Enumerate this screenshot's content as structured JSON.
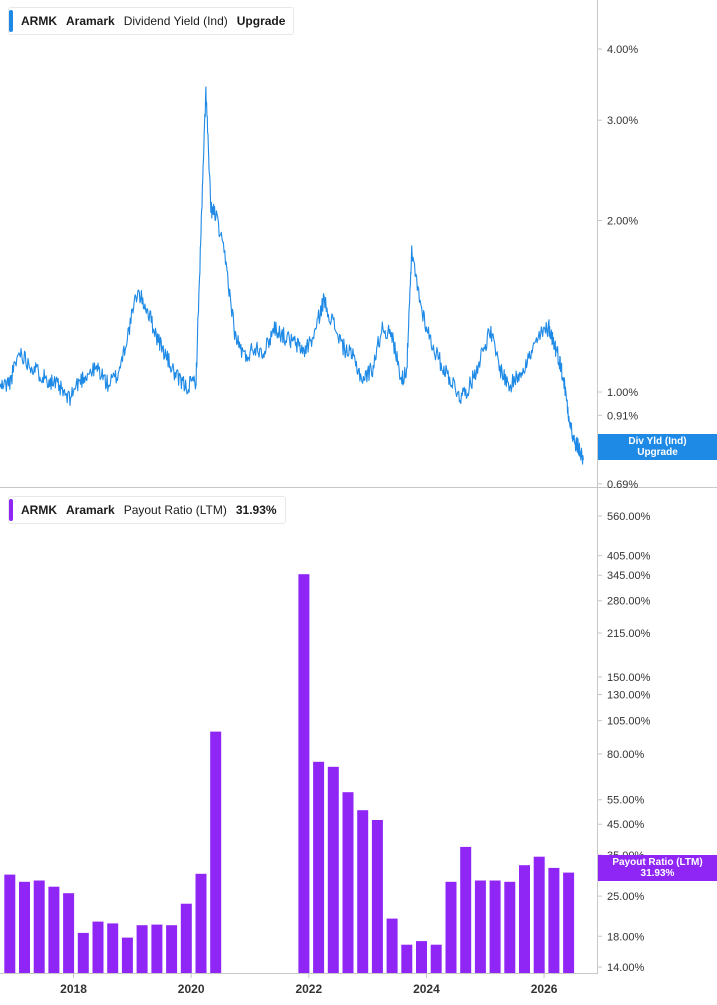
{
  "colors": {
    "yield": "#1e8ae6",
    "payout": "#9026f5",
    "axis": "#c8c8c8",
    "tick_text": "#333333"
  },
  "yield_panel": {
    "legend": {
      "ticker": "ARMK",
      "name": "Aramark",
      "metric": "Dividend Yield (Ind)",
      "value": "Upgrade"
    },
    "badge": {
      "line1": "Div Yld (Ind)",
      "line2": "Upgrade"
    }
  },
  "payout_panel": {
    "legend": {
      "ticker": "ARMK",
      "name": "Aramark",
      "metric": "Payout Ratio (LTM)",
      "value": "31.93%"
    },
    "badge": {
      "line1": "Payout Ratio (LTM)",
      "line2": "31.93%"
    }
  },
  "chart_data": [
    {
      "type": "line",
      "title": "ARMK Aramark Dividend Yield (Ind)",
      "series": [
        {
          "name": "Dividend Yield (Ind)",
          "unit": "%"
        }
      ],
      "y_scale": "log",
      "y_ticks": [
        {
          "value": 4.0,
          "label": "4.00%"
        },
        {
          "value": 3.0,
          "label": "3.00%"
        },
        {
          "value": 2.0,
          "label": "2.00%"
        },
        {
          "value": 1.0,
          "label": "1.00%"
        },
        {
          "value": 0.91,
          "label": "0.91%"
        },
        {
          "value": 0.69,
          "label": "0.69%"
        }
      ],
      "ylim": [
        0.69,
        4.5
      ],
      "xlim": [
        "2016-10",
        "2026-12"
      ],
      "x": [
        "2016-10",
        "2016-12",
        "2017-02",
        "2017-04",
        "2017-06",
        "2017-08",
        "2017-10",
        "2017-12",
        "2018-02",
        "2018-04",
        "2018-06",
        "2018-08",
        "2018-10",
        "2018-12",
        "2019-02",
        "2019-04",
        "2019-06",
        "2019-08",
        "2019-10",
        "2019-12",
        "2020-02",
        "2020-03",
        "2020-04",
        "2020-05",
        "2020-06",
        "2020-08",
        "2020-10",
        "2020-12",
        "2021-02",
        "2021-04",
        "2021-06",
        "2021-08",
        "2021-10",
        "2021-12",
        "2022-02",
        "2022-04",
        "2022-06",
        "2022-08",
        "2022-10",
        "2022-12",
        "2023-02",
        "2023-04",
        "2023-06",
        "2023-08",
        "2023-09",
        "2023-10",
        "2023-12",
        "2024-02",
        "2024-04",
        "2024-06",
        "2024-08",
        "2024-10",
        "2024-12",
        "2025-02",
        "2025-04",
        "2025-06",
        "2025-08",
        "2025-10",
        "2025-12",
        "2026-02",
        "2026-03",
        "2026-04",
        "2026-05",
        "2026-06",
        "2026-07",
        "2026-08",
        "2026-09"
      ],
      "values": [
        1.02,
        1.04,
        1.18,
        1.12,
        1.08,
        1.05,
        1.02,
        0.97,
        1.04,
        1.08,
        1.1,
        1.03,
        1.07,
        1.25,
        1.5,
        1.4,
        1.25,
        1.15,
        1.06,
        1.02,
        1.05,
        1.9,
        3.4,
        2.1,
        2.05,
        1.7,
        1.25,
        1.15,
        1.2,
        1.18,
        1.3,
        1.25,
        1.22,
        1.18,
        1.25,
        1.45,
        1.32,
        1.2,
        1.15,
        1.05,
        1.1,
        1.3,
        1.25,
        1.05,
        1.1,
        1.75,
        1.4,
        1.22,
        1.12,
        1.05,
        0.98,
        1.03,
        1.15,
        1.28,
        1.1,
        1.02,
        1.08,
        1.15,
        1.25,
        1.3,
        1.22,
        1.15,
        1.05,
        0.92,
        0.82,
        0.8,
        0.76
      ]
    },
    {
      "type": "bar",
      "title": "ARMK Aramark Payout Ratio (LTM)",
      "series": [
        {
          "name": "Payout Ratio (LTM)",
          "unit": "%"
        }
      ],
      "y_scale": "log",
      "y_ticks": [
        {
          "value": 560,
          "label": "560.00%"
        },
        {
          "value": 405,
          "label": "405.00%"
        },
        {
          "value": 345,
          "label": "345.00%"
        },
        {
          "value": 280,
          "label": "280.00%"
        },
        {
          "value": 215,
          "label": "215.00%"
        },
        {
          "value": 150,
          "label": "150.00%"
        },
        {
          "value": 130,
          "label": "130.00%"
        },
        {
          "value": 105,
          "label": "105.00%"
        },
        {
          "value": 80,
          "label": "80.00%"
        },
        {
          "value": 55,
          "label": "55.00%"
        },
        {
          "value": 45,
          "label": "45.00%"
        },
        {
          "value": 35,
          "label": "35.00%"
        },
        {
          "value": 25,
          "label": "25.00%"
        },
        {
          "value": 18,
          "label": "18.00%"
        },
        {
          "value": 14,
          "label": "14.00%"
        }
      ],
      "ylim": [
        13.5,
        600
      ],
      "xlim": [
        "2016-10",
        "2026-12"
      ],
      "x_ticks": [
        "2018",
        "2020",
        "2022",
        "2024",
        "2026"
      ],
      "x": [
        "2016-12",
        "2017-03",
        "2017-06",
        "2017-09",
        "2017-12",
        "2018-03",
        "2018-06",
        "2018-09",
        "2018-12",
        "2019-03",
        "2019-06",
        "2019-09",
        "2019-12",
        "2020-03",
        "2020-06",
        "2020-09",
        "2020-12",
        "2021-03",
        "2021-06",
        "2021-09",
        "2021-12",
        "2022-03",
        "2022-06",
        "2022-09",
        "2022-12",
        "2023-03",
        "2023-06",
        "2023-09",
        "2023-12",
        "2024-03",
        "2024-06",
        "2024-09",
        "2024-12",
        "2025-03",
        "2025-06",
        "2025-09",
        "2025-12",
        "2026-03",
        "2026-06"
      ],
      "values": [
        29.8,
        28.1,
        28.4,
        27.0,
        25.6,
        18.5,
        20.3,
        20.0,
        17.8,
        19.7,
        19.8,
        19.7,
        23.5,
        30.0,
        96.0,
        null,
        null,
        null,
        null,
        null,
        348.0,
        75.0,
        72.0,
        58.5,
        50.5,
        46.6,
        20.8,
        16.8,
        17.3,
        16.8,
        28.1,
        37.4,
        28.4,
        28.4,
        28.1,
        32.2,
        34.5,
        31.5,
        30.3
      ]
    }
  ]
}
